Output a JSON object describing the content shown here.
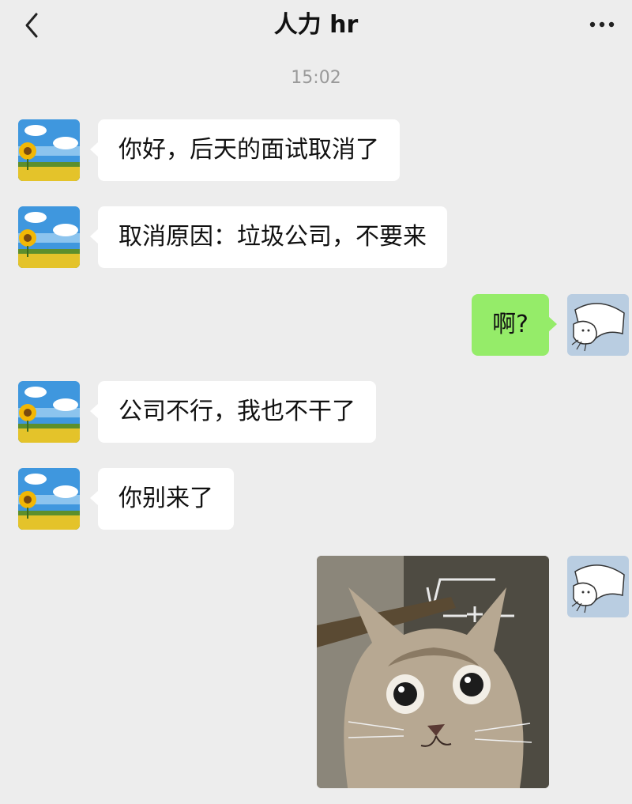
{
  "header": {
    "title": "人力 hr",
    "back_icon": "chevron-left-icon",
    "more_icon": "more-dots-icon"
  },
  "timestamp": "15:02",
  "messages": [
    {
      "side": "left",
      "sender": "hr",
      "text": "你好，后天的面试取消了"
    },
    {
      "side": "left",
      "sender": "hr",
      "text": "取消原因：垃圾公司，不要来"
    },
    {
      "side": "right",
      "sender": "me",
      "text": "啊?"
    },
    {
      "side": "left",
      "sender": "hr",
      "text": "公司不行，我也不干了"
    },
    {
      "side": "left",
      "sender": "hr",
      "text": "你别来了"
    },
    {
      "side": "right",
      "sender": "me",
      "type": "image",
      "description_icon": "cat-math-meme-image"
    }
  ],
  "colors": {
    "background": "#ededed",
    "bubble_left": "#ffffff",
    "bubble_right": "#95ec69",
    "timestamp": "#9a9a9a"
  }
}
